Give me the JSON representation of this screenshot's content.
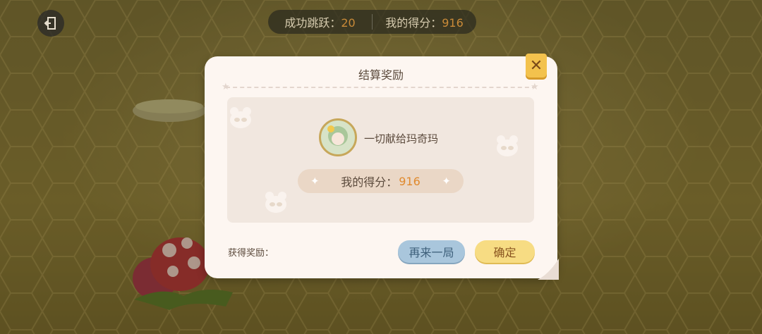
{
  "hud": {
    "jumps_label": "成功跳跃：",
    "jumps_value": "20",
    "score_label": "我的得分：",
    "score_value": "916"
  },
  "dialog": {
    "title": "结算奖励",
    "player_name": "一切献给玛奇玛",
    "score_label": "我的得分：",
    "score_value": "916",
    "reward_label": "获得奖励：",
    "again_button": "再来一局",
    "confirm_button": "确定",
    "close_glyph": "✕"
  },
  "colors": {
    "accent_orange": "#e08a2e",
    "button_blue": "#a9c6dc",
    "button_yellow": "#f7dc83",
    "close_yellow": "#f3c24d"
  },
  "icons": [
    "exit-icon",
    "close-icon",
    "sparkle-icon",
    "bear-face-icon",
    "avatar-icon",
    "mushroom-character"
  ]
}
